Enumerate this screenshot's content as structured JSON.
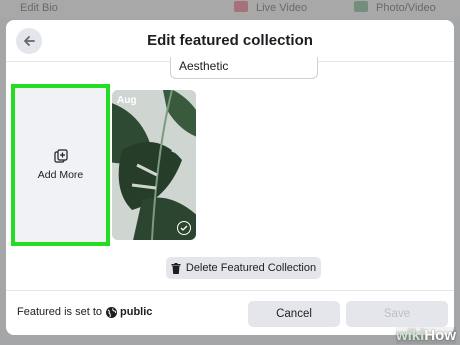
{
  "background": {
    "edit_bio": "Edit Bio",
    "live_video": "Live Video",
    "photo_video": "Photo/Video"
  },
  "modal": {
    "title": "Edit featured collection",
    "back_icon": "arrow-left-icon",
    "collection_name": "Aesthetic",
    "add_more_label": "Add More",
    "story": {
      "date": "Aug"
    },
    "delete_label": "Delete Featured Collection",
    "footer_prefix": "Featured is set to",
    "footer_audience": "public",
    "cancel_label": "Cancel",
    "save_label": "Save"
  },
  "watermark": {
    "wiki": "wiki",
    "how": "How"
  },
  "colors": {
    "highlight": "#22dd22",
    "button_bg": "#e4e6eb",
    "disabled_text": "#bcc0c4"
  }
}
